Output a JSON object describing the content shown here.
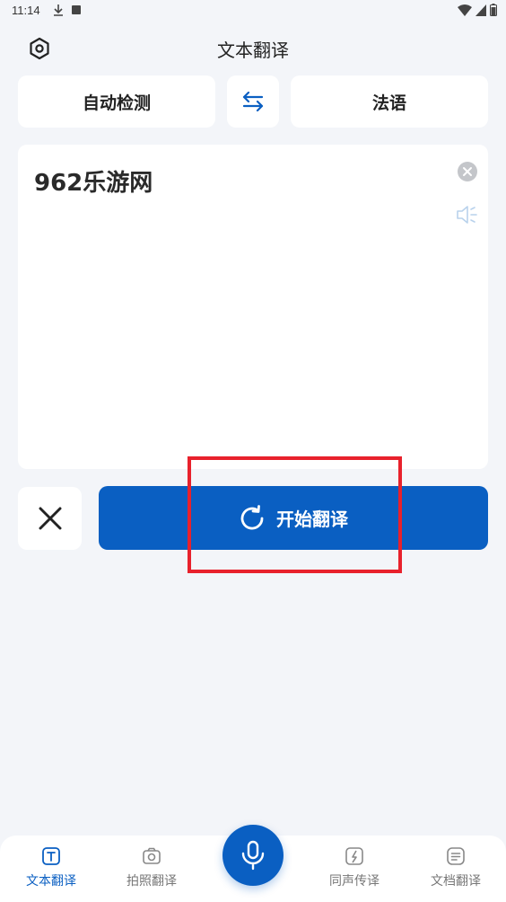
{
  "status_bar": {
    "time": "11:14"
  },
  "header": {
    "title": "文本翻译"
  },
  "languages": {
    "source": "自动检测",
    "target": "法语"
  },
  "input": {
    "text": "962乐游网"
  },
  "actions": {
    "translate_label": "开始翻译"
  },
  "bottom_nav": {
    "items": [
      {
        "label": "文本翻译",
        "icon": "text-icon",
        "active": true
      },
      {
        "label": "拍照翻译",
        "icon": "camera-icon",
        "active": false
      },
      {
        "label": "同声传译",
        "icon": "simultaneous-icon",
        "active": false
      },
      {
        "label": "文档翻译",
        "icon": "document-icon",
        "active": false
      }
    ]
  },
  "colors": {
    "accent": "#0a5fc2",
    "highlight": "#e8212c",
    "background": "#f3f5f9"
  }
}
